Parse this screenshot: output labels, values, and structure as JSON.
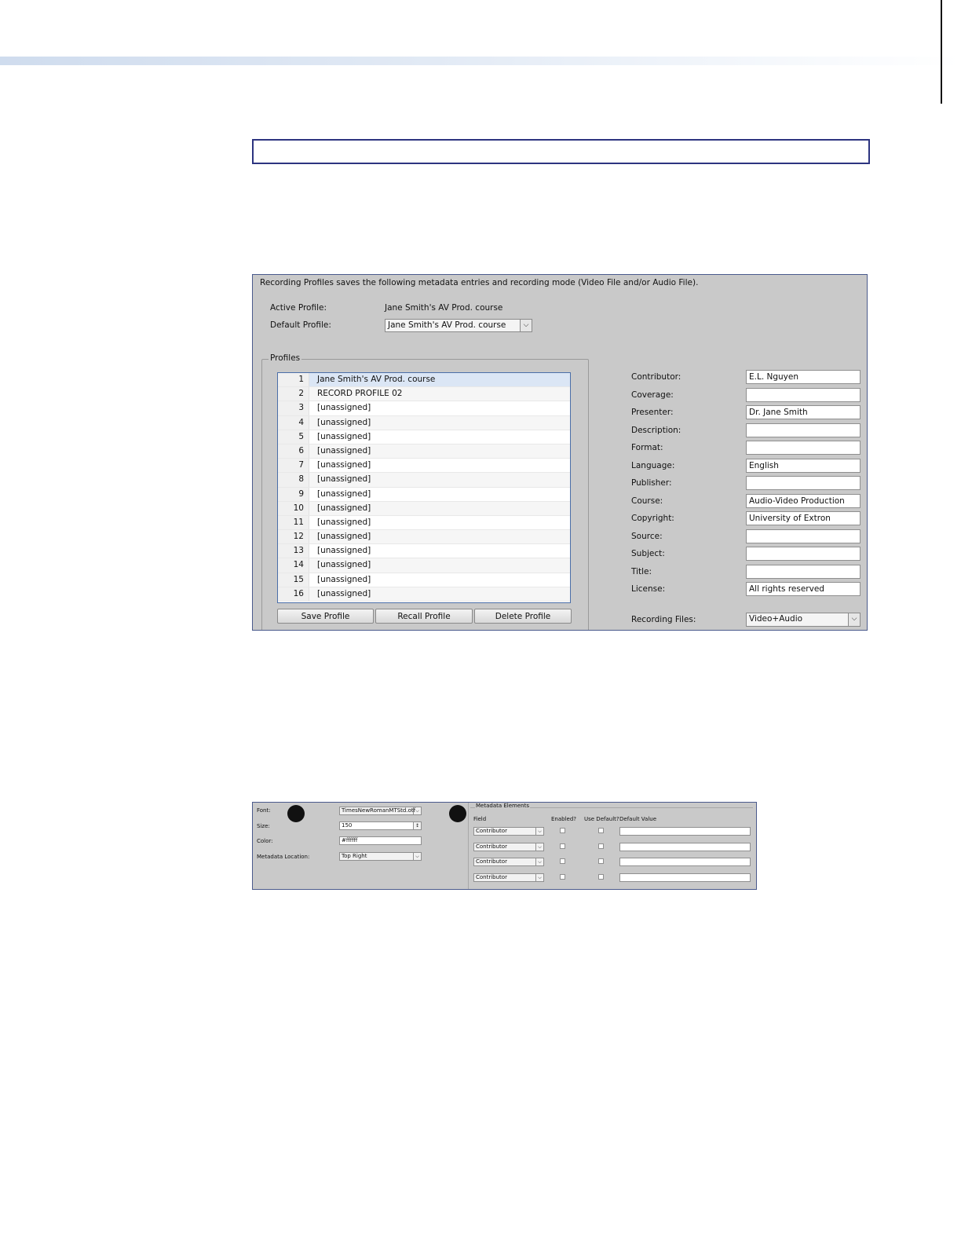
{
  "panel1": {
    "intro": "Recording Profiles saves the following metadata entries and recording mode (Video File and/or Audio File).",
    "active_profile_label": "Active Profile:",
    "active_profile_value": "Jane Smith's AV Prod. course",
    "default_profile_label": "Default Profile:",
    "default_profile_value": "Jane Smith's AV Prod. course",
    "profiles_legend": "Profiles",
    "profiles": [
      {
        "num": "1",
        "name": "Jane Smith's AV Prod. course"
      },
      {
        "num": "2",
        "name": "RECORD PROFILE 02"
      },
      {
        "num": "3",
        "name": "[unassigned]"
      },
      {
        "num": "4",
        "name": "[unassigned]"
      },
      {
        "num": "5",
        "name": "[unassigned]"
      },
      {
        "num": "6",
        "name": "[unassigned]"
      },
      {
        "num": "7",
        "name": "[unassigned]"
      },
      {
        "num": "8",
        "name": "[unassigned]"
      },
      {
        "num": "9",
        "name": "[unassigned]"
      },
      {
        "num": "10",
        "name": "[unassigned]"
      },
      {
        "num": "11",
        "name": "[unassigned]"
      },
      {
        "num": "12",
        "name": "[unassigned]"
      },
      {
        "num": "13",
        "name": "[unassigned]"
      },
      {
        "num": "14",
        "name": "[unassigned]"
      },
      {
        "num": "15",
        "name": "[unassigned]"
      },
      {
        "num": "16",
        "name": "[unassigned]"
      }
    ],
    "buttons": {
      "save": "Save Profile",
      "recall": "Recall Profile",
      "delete": "Delete Profile"
    },
    "metadata": [
      {
        "label": "Contributor:",
        "value": "E.L. Nguyen"
      },
      {
        "label": "Coverage:",
        "value": ""
      },
      {
        "label": "Presenter:",
        "value": "Dr. Jane Smith"
      },
      {
        "label": "Description:",
        "value": ""
      },
      {
        "label": "Format:",
        "value": ""
      },
      {
        "label": "Language:",
        "value": "English"
      },
      {
        "label": "Publisher:",
        "value": ""
      },
      {
        "label": "Course:",
        "value": "Audio-Video Production"
      },
      {
        "label": "Copyright:",
        "value": "University of Extron"
      },
      {
        "label": "Source:",
        "value": ""
      },
      {
        "label": "Subject:",
        "value": ""
      },
      {
        "label": "Title:",
        "value": ""
      },
      {
        "label": "License:",
        "value": "All rights reserved"
      }
    ],
    "recording_files_label": "Recording Files:",
    "recording_files_value": "Video+Audio"
  },
  "panel2": {
    "font_label": "Font:",
    "font_value": "TimesNewRomanMTStd.otf",
    "size_label": "Size:",
    "size_value": "150",
    "color_label": "Color:",
    "color_value": "#ffffff",
    "location_label": "Metadata Location:",
    "location_value": "Top Right",
    "metadata_legend": "Metadata Elements",
    "col_field": "Field",
    "col_enabled": "Enabled?",
    "col_use_default": "Use Default?",
    "col_default_value": "Default Value",
    "rows": [
      {
        "field": "Contributor",
        "default_value": ""
      },
      {
        "field": "Contributor",
        "default_value": ""
      },
      {
        "field": "Contributor",
        "default_value": ""
      },
      {
        "field": "Contributor",
        "default_value": ""
      }
    ]
  }
}
